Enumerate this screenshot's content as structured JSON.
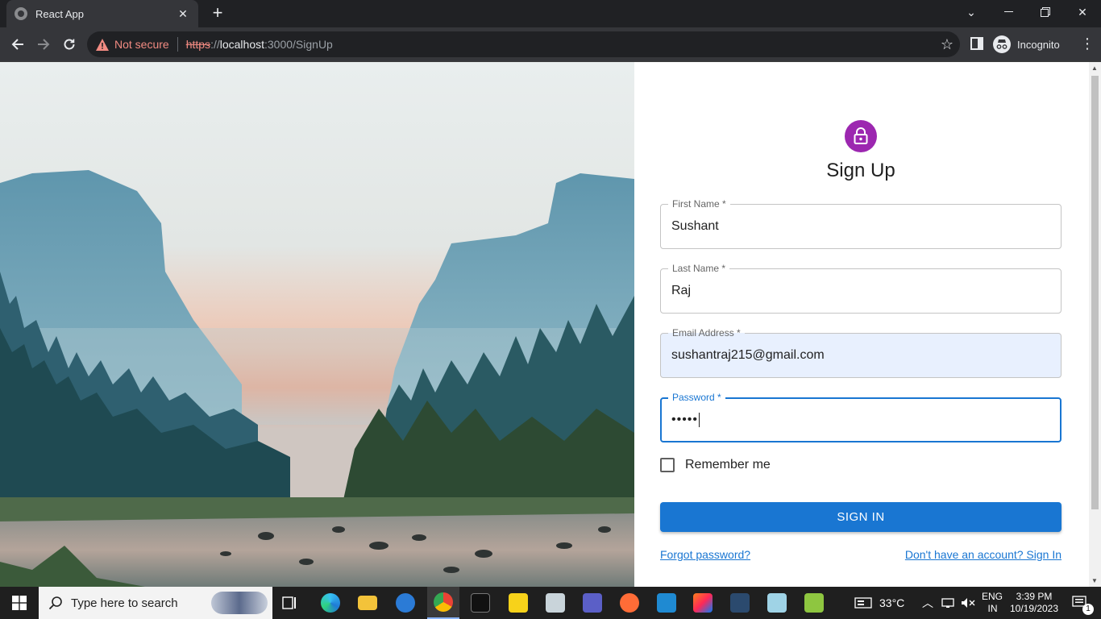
{
  "browser": {
    "tab_title": "React App",
    "omnibox": {
      "security_label": "Not secure",
      "url_scheme": "https",
      "url_sep": "://",
      "url_host": "localhost",
      "url_rest": ":3000/SignUp"
    },
    "profile_label": "Incognito"
  },
  "form": {
    "title": "Sign Up",
    "first_name": {
      "label": "First Name *",
      "value": "Sushant"
    },
    "last_name": {
      "label": "Last Name *",
      "value": "Raj"
    },
    "email": {
      "label": "Email Address *",
      "value": "sushantraj215@gmail.com"
    },
    "password": {
      "label": "Password *",
      "value": "•••••"
    },
    "remember_label": "Remember me",
    "submit_label": "SIGN IN",
    "forgot_link": "Forgot password?",
    "signup_link": "Don't have an account? Sign In",
    "accent_color": "#1976d2",
    "avatar_color": "#9c27b0"
  },
  "taskbar": {
    "search_placeholder": "Type here to search",
    "weather": "33°C",
    "lang_top": "ENG",
    "lang_bottom": "IN",
    "time": "3:39 PM",
    "date": "10/19/2023",
    "notification_count": "1"
  }
}
